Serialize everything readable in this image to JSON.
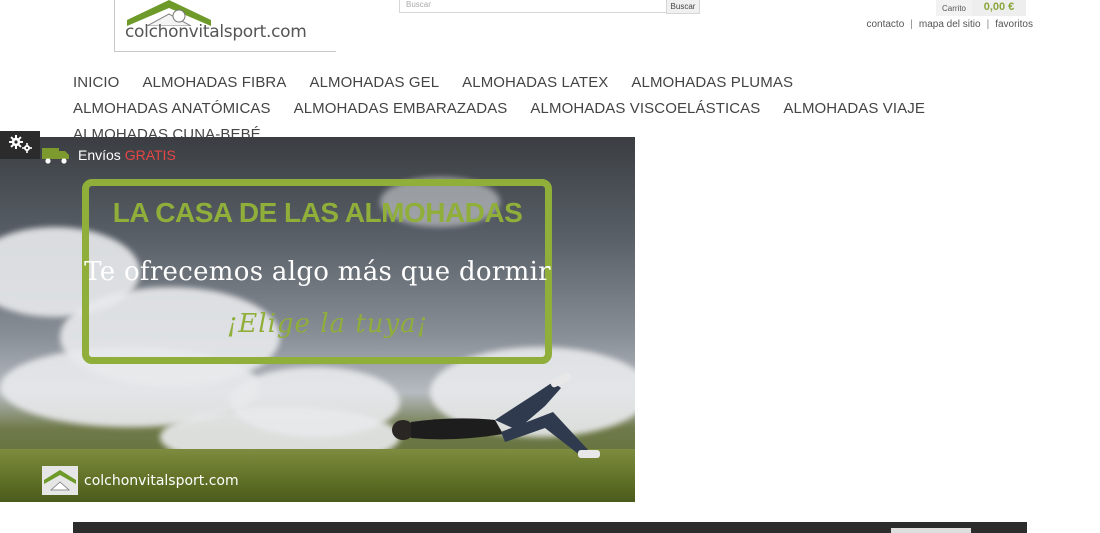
{
  "header": {
    "logo_text_a": "colchon",
    "logo_text_b": "vitalsport.com",
    "search": {
      "placeholder": "Buscar",
      "button_label": "Buscar"
    },
    "cart": {
      "label": "Carrito",
      "total": "0,00 €"
    },
    "top_links": [
      "contacto",
      "mapa del sitio",
      "favoritos"
    ]
  },
  "nav": {
    "items": [
      "INICIO",
      "ALMOHADAS FIBRA",
      "ALMOHADAS GEL",
      "ALMOHADAS LATEX",
      "ALMOHADAS PLUMAS",
      "ALMOHADAS ANATÓMICAS",
      "ALMOHADAS EMBARAZADAS",
      "ALMOHADAS VISCOELÁSTICAS",
      "ALMOHADAS VIAJE",
      "ALMOHADAS CUNA-BEBÉ"
    ]
  },
  "banner": {
    "shipping_text": "Envíos",
    "shipping_highlight": "GRATIS",
    "title": "LA CASA DE LAS ALMOHADAS",
    "subtitle": "Te ofrecemos algo más que dormir",
    "cta": "¡Elige la tuya¡",
    "logo_text": "colchonvitalsport.com"
  },
  "colors": {
    "accent_green": "#8fae3a",
    "highlight_red": "#e84545"
  }
}
